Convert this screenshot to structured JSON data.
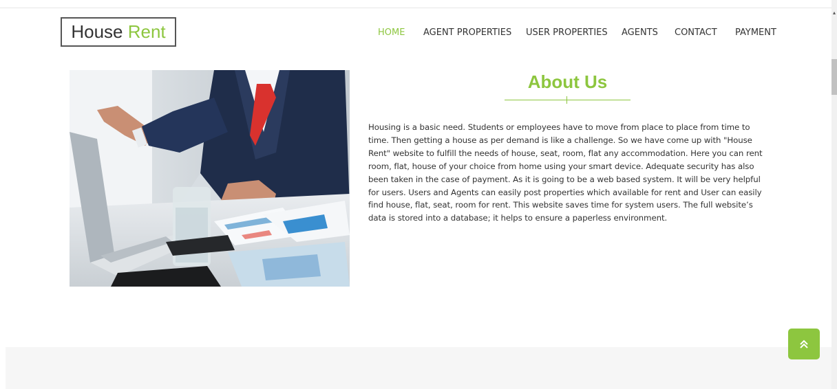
{
  "brand": {
    "part1": "House",
    "part2": "Rent"
  },
  "nav": {
    "items": [
      {
        "label": "HOME",
        "active": true
      },
      {
        "label": "AGENT PROPERTIES",
        "active": false
      },
      {
        "label": "USER PROPERTIES",
        "active": false
      },
      {
        "label": "AGENTS",
        "active": false
      },
      {
        "label": "CONTACT",
        "active": false
      },
      {
        "label": "PAYMENT",
        "active": false
      }
    ]
  },
  "about": {
    "title": "About Us",
    "body": "Housing is a basic need. Students or employees have to move from place to place from time to time. Then getting a house as per demand is like a challenge. So we have come up with \"House Rent\" website to fulfill the needs of house, seat, room, flat any accommodation. Here you can rent room, flat, house of your choice from home using your smart device. Adequate security has also been taken in the case of payment. As it is going to be a web based system. It will be very helpful for users. Users and Agents can easily post properties which available for rent and User can easily find house, flat, seat, room for rent. This website saves time for system users. The full website’s data is stored into a database; it helps to ensure a paperless environment."
  },
  "icons": {
    "back_to_top": "double-chevron-up-icon",
    "scroll_up": "triangle-up-icon"
  },
  "colors": {
    "accent": "#8dc63f",
    "text": "#333333",
    "footer_band": "#f6f6f6"
  }
}
